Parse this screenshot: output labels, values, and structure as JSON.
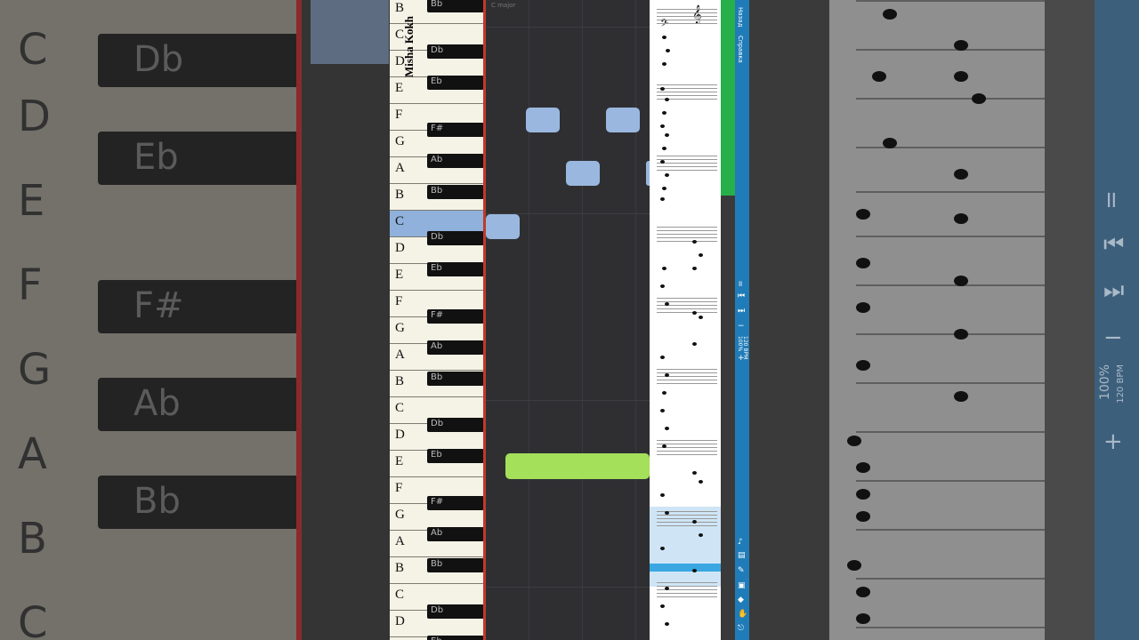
{
  "author": "Misha Kokh",
  "key_label": "C major",
  "piano": {
    "white_keys": [
      "B",
      "C",
      "D",
      "E",
      "F",
      "G",
      "A",
      "B",
      "C",
      "D",
      "E",
      "F",
      "G",
      "A",
      "B",
      "C",
      "D",
      "E",
      "F",
      "G",
      "A",
      "B",
      "C",
      "D"
    ],
    "black_keys": [
      "Bb",
      "Db",
      "Eb",
      "F#",
      "Ab",
      "Bb",
      "Db",
      "Eb",
      "F#",
      "Ab",
      "Bb",
      "Db",
      "Eb",
      "F#",
      "Ab",
      "Bb",
      "Db",
      "Eb"
    ]
  },
  "bg_piano": {
    "white_keys": [
      "C",
      "D",
      "E",
      "F",
      "G",
      "A",
      "B",
      "C"
    ],
    "black_keys": [
      "Db",
      "Eb",
      "F#",
      "Ab",
      "Bb"
    ]
  },
  "side_panel": {
    "new_label": "Назад",
    "help_label": "Справка",
    "zoom": "100%",
    "tempo": "120 BPM",
    "pause_icon": "pause-icon",
    "prev_icon": "skip-back-icon",
    "next_icon": "skip-forward-icon"
  },
  "right_panel": {
    "zoom": "100%",
    "tempo": "120 BPM",
    "minus": "−",
    "plus": "+"
  },
  "colors": {
    "note_blue": "#9ab8df",
    "note_green": "#a4e05a",
    "panel_blue": "#1f7cb8",
    "playhead_red": "#c0392b"
  }
}
